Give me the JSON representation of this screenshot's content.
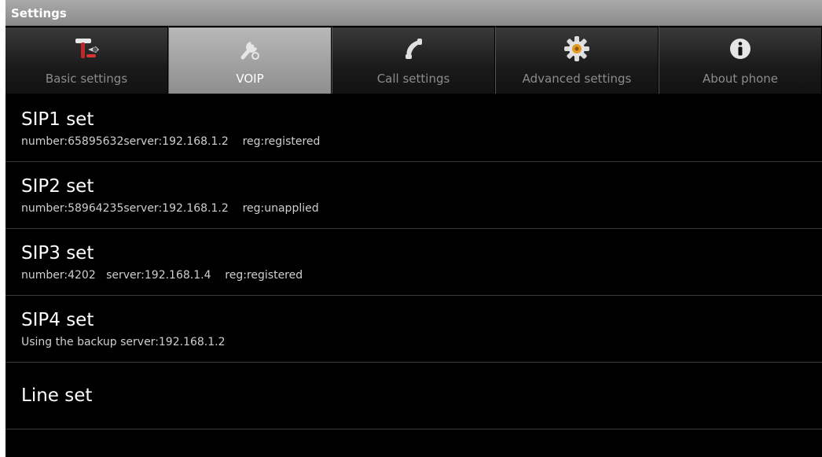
{
  "window": {
    "title": "Settings"
  },
  "tabs": [
    {
      "label": "Basic settings",
      "icon": "tools-icon",
      "selected": false
    },
    {
      "label": "VOIP",
      "icon": "wrench-icon",
      "selected": true
    },
    {
      "label": "Call settings",
      "icon": "phone-handset-icon",
      "selected": false
    },
    {
      "label": "Advanced settings",
      "icon": "gear-icon",
      "selected": false
    },
    {
      "label": "About phone",
      "icon": "info-icon",
      "selected": false
    }
  ],
  "items": [
    {
      "title": "SIP1 set",
      "subtitle": "number:65895632server:192.168.1.2    reg:registered"
    },
    {
      "title": "SIP2 set",
      "subtitle": "number:58964235server:192.168.1.2    reg:unapplied"
    },
    {
      "title": "SIP3 set",
      "subtitle": "number:4202   server:192.168.1.4    reg:registered"
    },
    {
      "title": "SIP4 set",
      "subtitle": "Using the backup server:192.168.1.2"
    },
    {
      "title": "Line set",
      "subtitle": ""
    }
  ],
  "colors": {
    "selected_tab": "#a4a4a4",
    "title_bar": "#9a9a9a",
    "background": "#000000"
  }
}
